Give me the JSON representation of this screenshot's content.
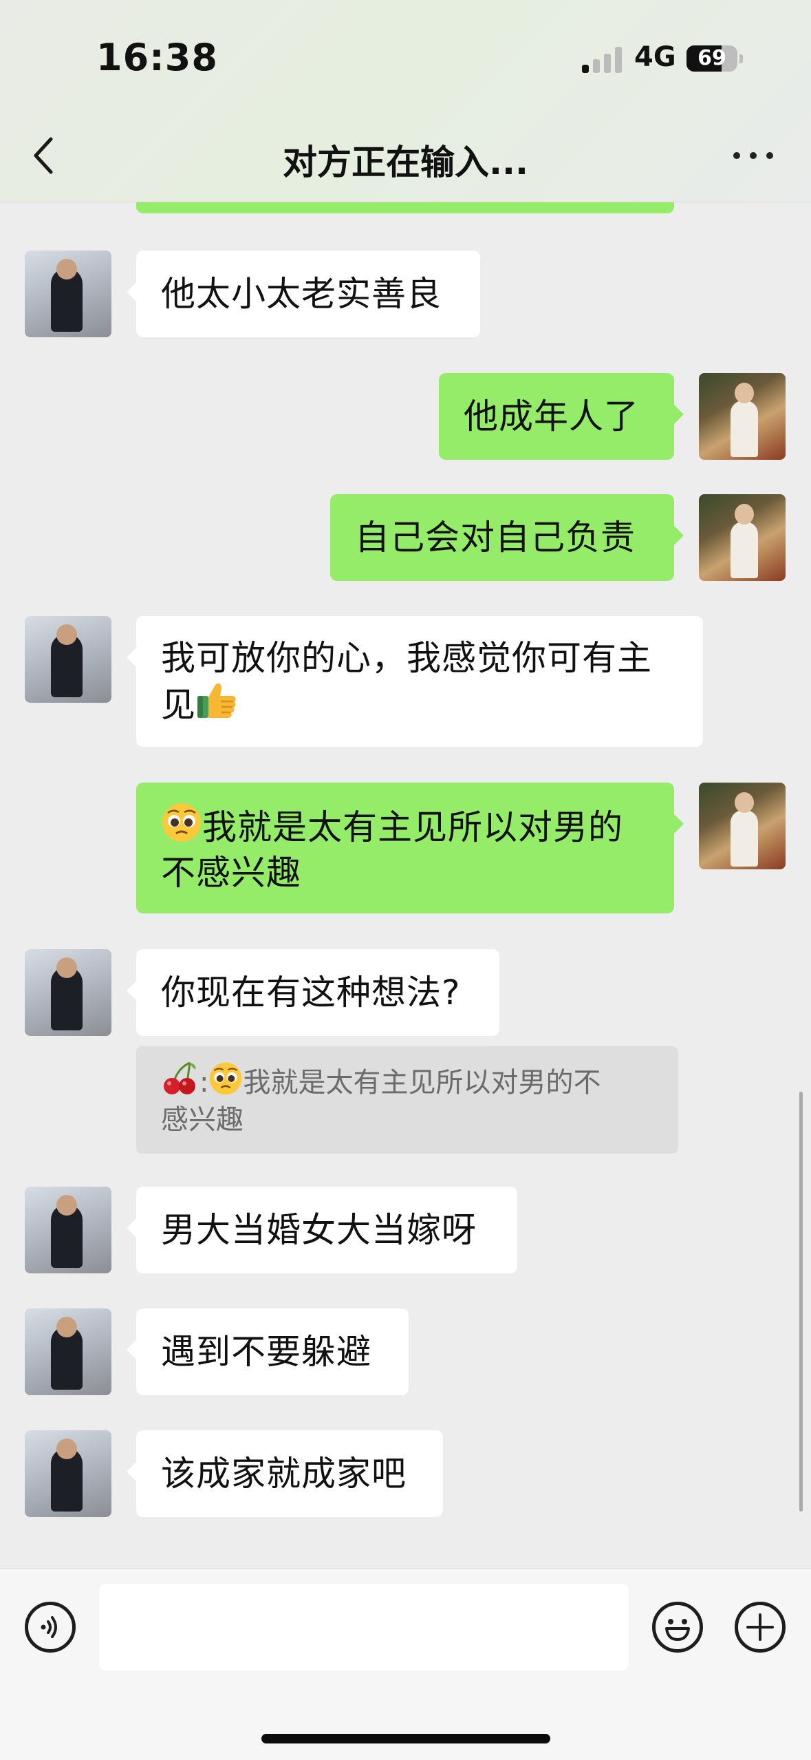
{
  "status_bar": {
    "time": "16:38",
    "network": "4G",
    "battery": "69",
    "battery_level": 0.69
  },
  "header": {
    "title": "对方正在输入..."
  },
  "messages": [
    {
      "side": "in",
      "text": "他太小太老实善良"
    },
    {
      "side": "out",
      "text": "他成年人了"
    },
    {
      "side": "out",
      "text": "自己会对自己负责"
    },
    {
      "side": "in",
      "line1": "我可放你的心，我感觉你可有主",
      "line2": "见"
    },
    {
      "side": "out",
      "line1": "我就是太有主见所以对男的",
      "line2": "不感兴趣"
    },
    {
      "side": "in",
      "text": "你现在有这种想法?"
    },
    {
      "side": "in",
      "text": "男大当婚女大当嫁呀"
    },
    {
      "side": "in",
      "text": "遇到不要躲避"
    },
    {
      "side": "in",
      "text": "该成家就成家吧"
    }
  ],
  "quote": {
    "separator": ":",
    "line1": "我就是太有主见所以对男的不",
    "line2": "感兴趣"
  },
  "icons": {
    "thumbs_up": "thumbs-up-emoji",
    "pleading": "pleading-face-emoji",
    "cherry": "cherry-emoji",
    "voice": "voice-icon",
    "emoji": "smiley-icon",
    "plus": "plus-icon"
  },
  "colors": {
    "outgoing_bubble": "#95ec69",
    "incoming_bubble": "#ffffff",
    "chat_background": "#ededed"
  }
}
